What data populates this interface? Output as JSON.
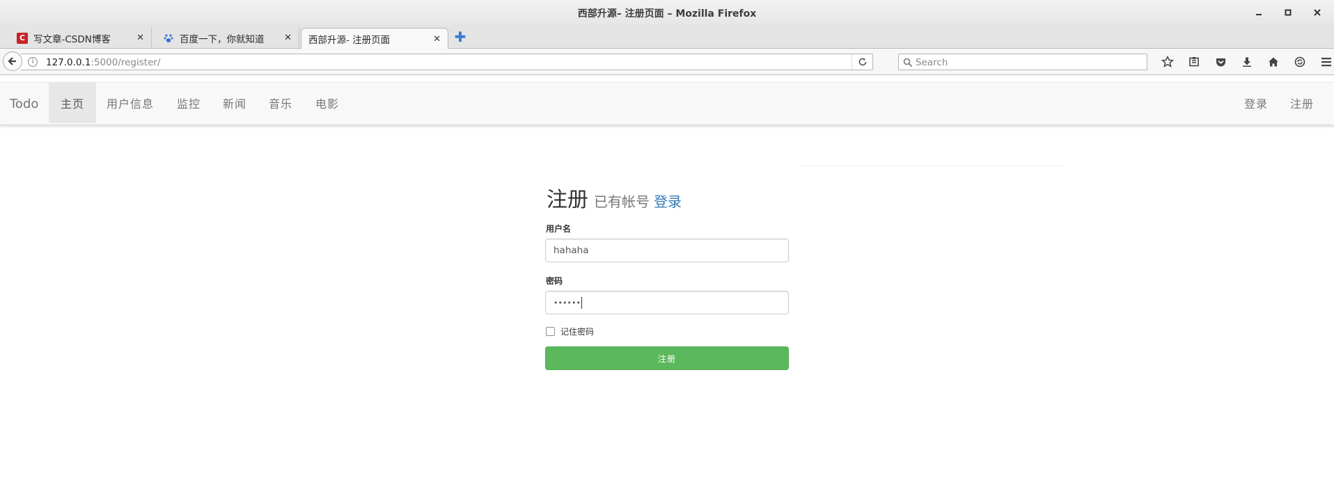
{
  "window": {
    "title": "西部升源– 注册页面 – Mozilla Firefox",
    "controls": [
      "minimize-icon",
      "maximize-icon",
      "close-icon"
    ]
  },
  "tabs": [
    {
      "title": "写文章-CSDN博客",
      "icon": "csdn-icon",
      "active": false
    },
    {
      "title": "百度一下，你就知道",
      "icon": "baidu-paw-icon",
      "active": false
    },
    {
      "title": "西部升源- 注册页面",
      "icon": "",
      "active": true
    }
  ],
  "urlbar": {
    "host": "127.0.0.1",
    "path": ":5000/register/"
  },
  "searchbar": {
    "placeholder": "Search"
  },
  "toolbar_icons": [
    "bookmark-star-icon",
    "reading-list-icon",
    "pocket-icon",
    "download-icon",
    "home-icon",
    "sync-icon",
    "menu-icon"
  ],
  "site_nav": {
    "brand": "Todo",
    "items": [
      "主页",
      "用户信息",
      "监控",
      "新闻",
      "音乐",
      "电影"
    ],
    "active_index": 0,
    "right_items": [
      "登录",
      "注册"
    ]
  },
  "form": {
    "heading": "注册",
    "subheading": "已有帐号",
    "login_link": "登录",
    "username_label": "用户名",
    "username_value": "hahaha",
    "password_label": "密码",
    "password_masked": "••••••",
    "remember_label": "记住密码",
    "remember_checked": false,
    "submit_label": "注册",
    "submit_color": "#5cb85c",
    "link_color": "#337ab7"
  }
}
